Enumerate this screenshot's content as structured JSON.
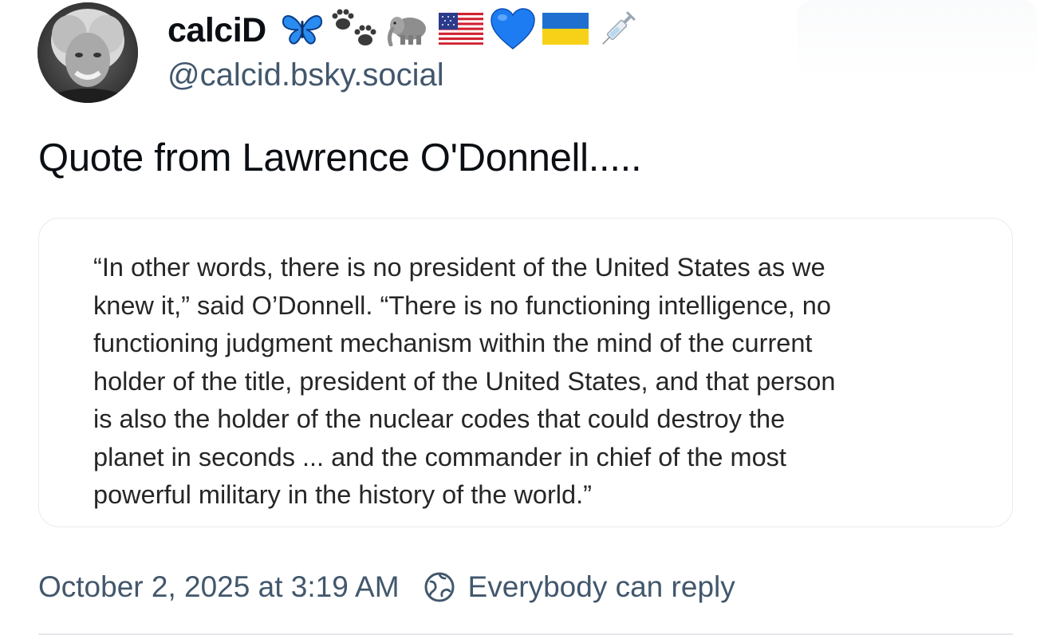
{
  "author": {
    "display_name": "calciD",
    "handle": "@calcid.bsky.social",
    "name_icons": [
      "butterfly-icon",
      "paw-prints-icon",
      "elephant-icon",
      "us-flag-icon",
      "blue-heart-icon",
      "ukraine-flag-icon",
      "syringe-icon"
    ],
    "avatar": "avatar"
  },
  "post": {
    "text": "Quote from Lawrence O'Donnell.....",
    "quote_lines": [
      "“In other words, there is no president of the United States as we",
      "knew it,” said O’Donnell. “There is no functioning intelligence, no",
      "functioning judgment mechanism within the mind of the current",
      "holder of the title, president of the United States, and that person",
      "is also the holder of the nuclear codes that could destroy the",
      "planet in seconds ... and the commander in chief of the most",
      "powerful military in the history of the world.”"
    ]
  },
  "meta": {
    "timestamp": "October 2, 2025 at 3:19 AM",
    "reply_setting": "Everybody can reply",
    "reply_icon": "globe-icon"
  },
  "colors": {
    "text_primary": "#0b0f14",
    "text_secondary": "#42576c",
    "quote_text": "#262626",
    "card_border": "#e7ebef",
    "heart_blue": "#1d7cf2"
  }
}
